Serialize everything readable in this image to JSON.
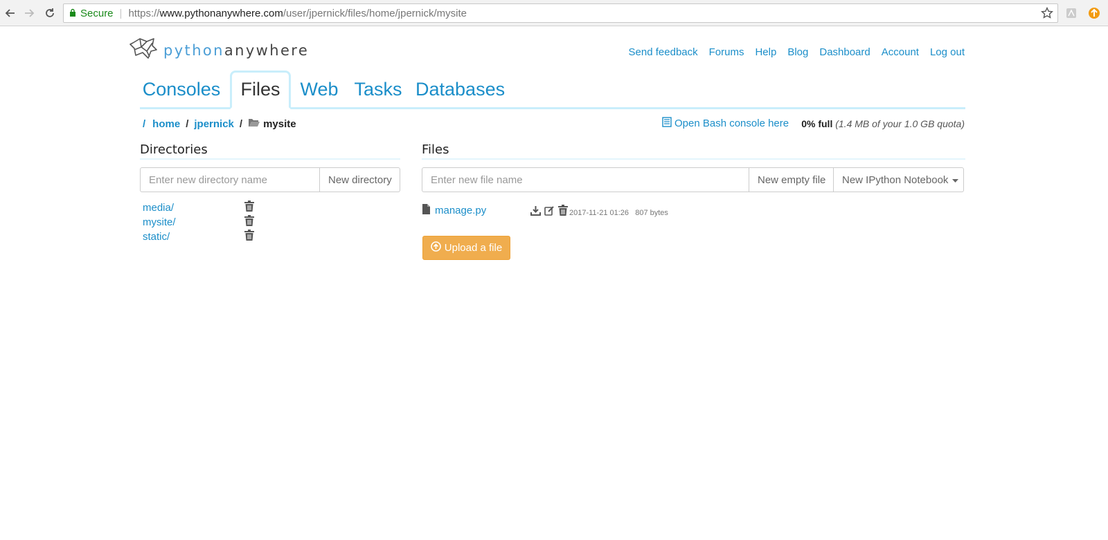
{
  "browser": {
    "secure_label": "Secure",
    "url_scheme": "https://",
    "url_host": "www.pythonanywhere.com",
    "url_path": "/user/jpernick/files/home/jpernick/mysite"
  },
  "logo": {
    "python": "python",
    "anywhere": "anywhere"
  },
  "top_links": [
    "Send feedback",
    "Forums",
    "Help",
    "Blog",
    "Dashboard",
    "Account",
    "Log out"
  ],
  "tabs": [
    "Consoles",
    "Files",
    "Web",
    "Tasks",
    "Databases"
  ],
  "active_tab": "Files",
  "breadcrumb": {
    "root": "/",
    "parts": [
      "home",
      "jpernick"
    ],
    "current": "mysite"
  },
  "bash_link": "Open Bash console here",
  "quota": {
    "percent": "0% full",
    "detail": "(1.4 MB of your 1.0 GB quota)"
  },
  "directories": {
    "title": "Directories",
    "placeholder": "Enter new directory name",
    "button": "New directory",
    "items": [
      "media/",
      "mysite/",
      "static/"
    ]
  },
  "files": {
    "title": "Files",
    "placeholder": "Enter new file name",
    "new_empty_button": "New empty file",
    "new_notebook_button": "New IPython Notebook",
    "items": [
      {
        "name": "manage.py",
        "modified": "2017-11-21 01:26",
        "size": "807 bytes"
      }
    ],
    "upload_button": "Upload a file"
  },
  "colors": {
    "link": "#1b8ec9",
    "tab_border": "#c9eefb",
    "upload": "#f0ad4e"
  }
}
